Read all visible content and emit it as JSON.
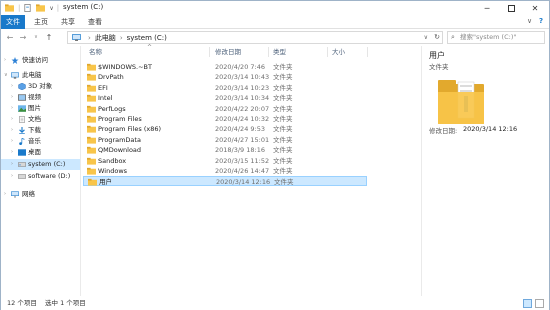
{
  "window": {
    "title": "system (C:)",
    "quick_access_chevron": "∨"
  },
  "ribbon": {
    "tabs": [
      {
        "label": "文件",
        "active": true
      },
      {
        "label": "主页",
        "active": false
      },
      {
        "label": "共享",
        "active": false
      },
      {
        "label": "查看",
        "active": false
      }
    ],
    "expand_icon": "∨",
    "help_icon": "?"
  },
  "address": {
    "crumbs": [
      "此电脑",
      "system (C:)"
    ],
    "separator": "›",
    "search_placeholder": "搜索\"system (C:)\""
  },
  "nav": {
    "items": [
      {
        "label": "快速访问",
        "icon": "star-icon"
      },
      {
        "label": "此电脑",
        "icon": "computer-icon"
      },
      {
        "label": "3D 对象",
        "icon": "cube-icon"
      },
      {
        "label": "视频",
        "icon": "video-icon"
      },
      {
        "label": "图片",
        "icon": "picture-icon"
      },
      {
        "label": "文档",
        "icon": "document-icon"
      },
      {
        "label": "下载",
        "icon": "download-icon"
      },
      {
        "label": "音乐",
        "icon": "music-icon"
      },
      {
        "label": "桌面",
        "icon": "desktop-icon"
      },
      {
        "label": "system (C:)",
        "icon": "drive-icon"
      },
      {
        "label": "software (D:)",
        "icon": "drive-icon"
      },
      {
        "label": "网络",
        "icon": "network-icon"
      }
    ]
  },
  "list": {
    "headers": {
      "name": "名称",
      "date": "修改日期",
      "type": "类型",
      "size": "大小"
    },
    "sort_arrow": "^",
    "rows": [
      {
        "name": "$WINDOWS.~BT",
        "date": "2020/4/20 7:46",
        "type": "文件夹"
      },
      {
        "name": "DrvPath",
        "date": "2020/3/14 10:43",
        "type": "文件夹"
      },
      {
        "name": "EFI",
        "date": "2020/3/14 10:23",
        "type": "文件夹"
      },
      {
        "name": "Intel",
        "date": "2020/3/14 10:34",
        "type": "文件夹"
      },
      {
        "name": "PerfLogs",
        "date": "2020/4/22 20:07",
        "type": "文件夹"
      },
      {
        "name": "Program Files",
        "date": "2020/4/24 10:32",
        "type": "文件夹"
      },
      {
        "name": "Program Files (x86)",
        "date": "2020/4/24 9:53",
        "type": "文件夹"
      },
      {
        "name": "ProgramData",
        "date": "2020/4/27 15:01",
        "type": "文件夹"
      },
      {
        "name": "QMDownload",
        "date": "2018/3/9 18:16",
        "type": "文件夹"
      },
      {
        "name": "Sandbox",
        "date": "2020/3/15 11:52",
        "type": "文件夹"
      },
      {
        "name": "Windows",
        "date": "2020/4/26 14:47",
        "type": "文件夹"
      },
      {
        "name": "用户",
        "date": "2020/3/14 12:16",
        "type": "文件夹"
      }
    ]
  },
  "preview": {
    "name": "用户",
    "type": "文件夹",
    "modified_label": "修改日期:",
    "modified_value": "2020/3/14 12:16"
  },
  "status": {
    "count": "12 个项目",
    "selected": "选中 1 个项目"
  },
  "colors": {
    "accent": "#1979ca",
    "selection": "#cce8ff",
    "folder": "#f8c54a"
  }
}
